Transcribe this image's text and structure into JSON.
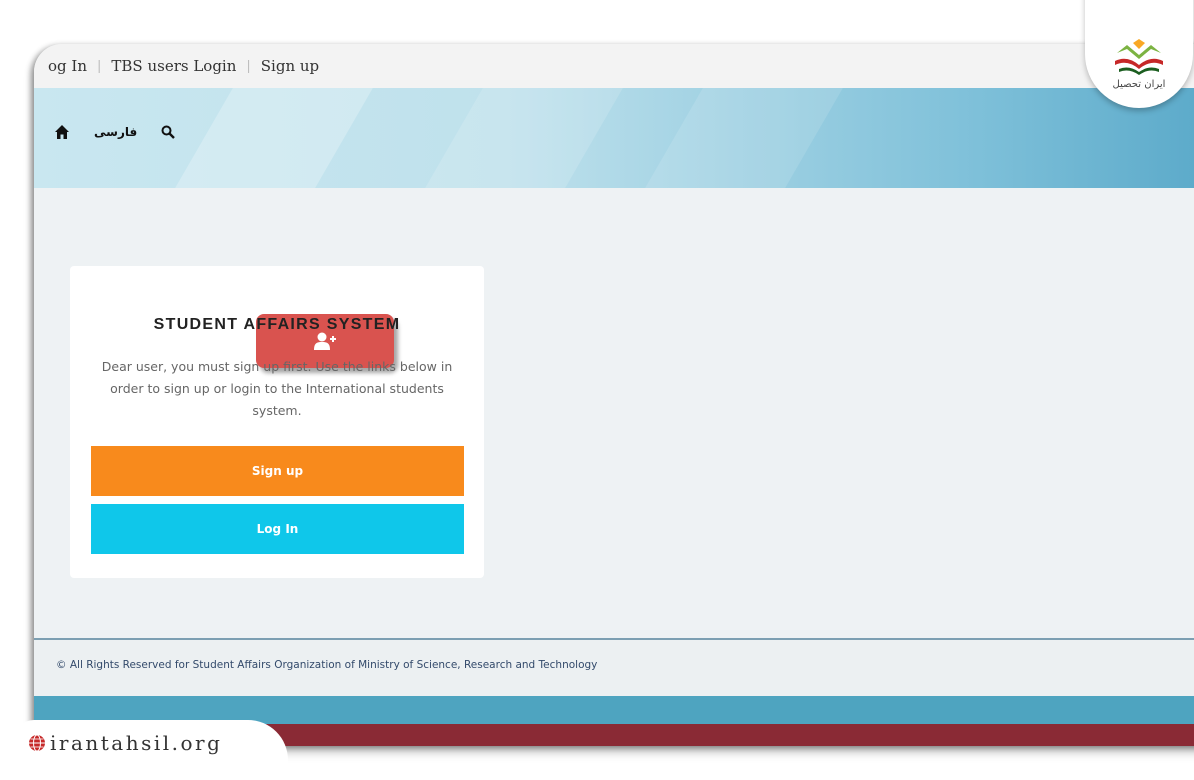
{
  "topbar": {
    "links": [
      "og In",
      "TBS users Login",
      "Sign up"
    ]
  },
  "nav": {
    "home_icon": "home-icon",
    "language_label": "فارسی",
    "search_icon": "search-icon"
  },
  "card": {
    "badge_icon": "add-user-icon",
    "title": "STUDENT AFFAIRS SYSTEM",
    "description": "Dear user, you must sign up first. Use the links below in order to sign up or login to the International students system.",
    "signup_label": "Sign up",
    "login_label": "Log In"
  },
  "footer": {
    "copyright": "© All Rights Reserved for Student Affairs Organization of Ministry of Science, Research and Technology"
  },
  "logo": {
    "text": "ایران تحصیل"
  },
  "watermark": {
    "text": "irantahsil.org"
  },
  "colors": {
    "signup": "#f88a1c",
    "login": "#0fc7ea",
    "badge": "#d9534f",
    "banner": "#7ec0d9"
  }
}
